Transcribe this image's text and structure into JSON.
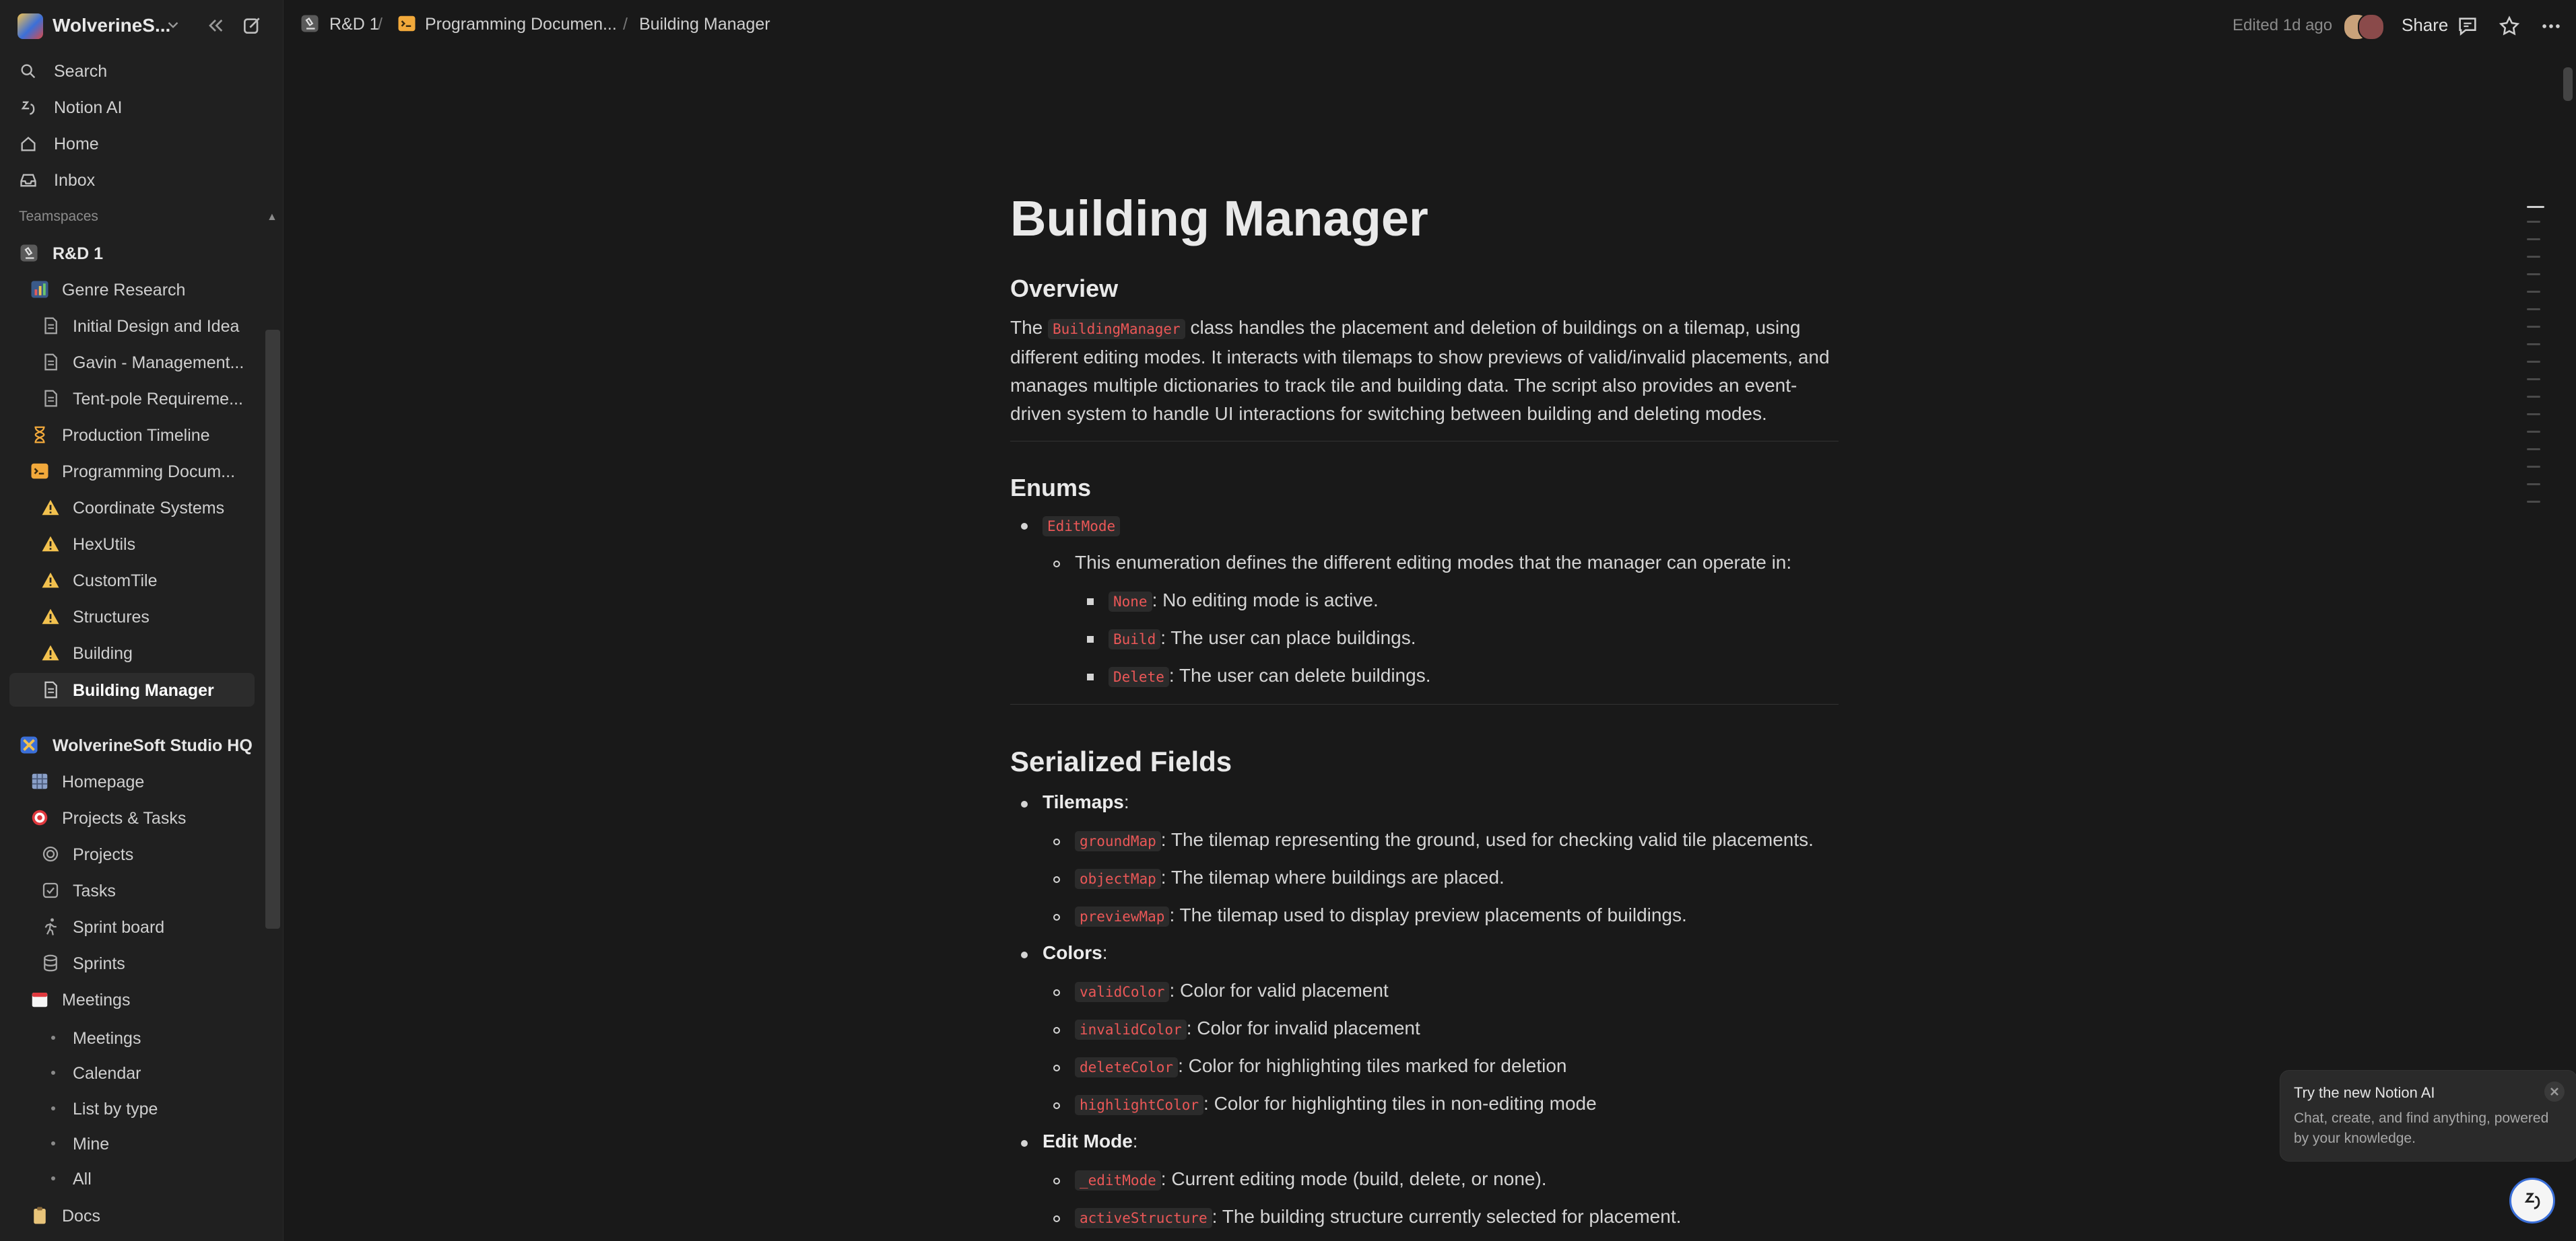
{
  "workspace": {
    "name": "WolverineS..."
  },
  "nav": [
    {
      "label": "Search",
      "icon": "search-icon"
    },
    {
      "label": "Notion AI",
      "icon": "notion-ai-icon"
    },
    {
      "label": "Home",
      "icon": "home-icon"
    },
    {
      "label": "Inbox",
      "icon": "inbox-icon"
    }
  ],
  "sidebar": {
    "section_label": "Teamspaces",
    "tree": [
      {
        "label": "R&D 1"
      },
      {
        "label": "Genre Research"
      },
      {
        "label": "Initial Design and Idea"
      },
      {
        "label": "Gavin - Management..."
      },
      {
        "label": "Tent-pole Requireme..."
      },
      {
        "label": "Production Timeline"
      },
      {
        "label": "Programming Docum..."
      },
      {
        "label": "Coordinate Systems"
      },
      {
        "label": "HexUtils"
      },
      {
        "label": "CustomTile"
      },
      {
        "label": "Structures"
      },
      {
        "label": "Building"
      },
      {
        "label": "Building Manager"
      },
      {
        "label": "WolverineSoft Studio HQ"
      },
      {
        "label": "Homepage"
      },
      {
        "label": "Projects & Tasks"
      },
      {
        "label": "Projects"
      },
      {
        "label": "Tasks"
      },
      {
        "label": "Sprint board"
      },
      {
        "label": "Sprints"
      },
      {
        "label": "Meetings"
      },
      {
        "label": "Meetings"
      },
      {
        "label": "Calendar"
      },
      {
        "label": "List by type"
      },
      {
        "label": "Mine"
      },
      {
        "label": "All"
      },
      {
        "label": "Docs"
      }
    ]
  },
  "topbar": {
    "breadcrumbs": [
      {
        "label": "R&D 1"
      },
      {
        "label": "Programming Documen..."
      },
      {
        "label": "Building Manager"
      }
    ],
    "separator": "/",
    "edited": "Edited 1d ago",
    "share": "Share"
  },
  "page": {
    "title": "Building Manager",
    "overview_heading": "Overview",
    "overview": {
      "pre": "The ",
      "code": "BuildingManager",
      "post": " class handles the placement and deletion of buildings on a tilemap, using different editing modes. It interacts with tilemaps to show previews of valid/invalid placements, and manages multiple dictionaries to track tile and building data. The script also provides an event-driven system to handle UI interactions for switching between building and deleting modes."
    },
    "enums_heading": "Enums",
    "enum_name": "EditMode",
    "enum_desc": "This enumeration defines the different editing modes that the manager can operate in:",
    "enum_values": [
      {
        "code": "None",
        "text": ": No editing mode is active."
      },
      {
        "code": "Build",
        "text": ": The user can place buildings."
      },
      {
        "code": "Delete",
        "text": ": The user can delete buildings."
      }
    ],
    "serialized_heading": "Serialized Fields",
    "groups": [
      {
        "label": "Tilemaps",
        "colon": ":",
        "items": [
          {
            "code": "groundMap",
            "text": ": The tilemap representing the ground, used for checking valid tile placements."
          },
          {
            "code": "objectMap",
            "text": ": The tilemap where buildings are placed."
          },
          {
            "code": "previewMap",
            "text": ": The tilemap used to display preview placements of buildings."
          }
        ]
      },
      {
        "label": "Colors",
        "colon": ":",
        "items": [
          {
            "code": "validColor",
            "text": ": Color for valid placement"
          },
          {
            "code": "invalidColor",
            "text": ": Color for invalid placement"
          },
          {
            "code": "deleteColor",
            "text": ": Color for highlighting tiles marked for deletion"
          },
          {
            "code": "highlightColor",
            "text": ": Color for highlighting tiles in non-editing mode"
          }
        ]
      },
      {
        "label": "Edit Mode",
        "colon": ":",
        "items": [
          {
            "code": "_editMode",
            "text": ": Current editing mode (build, delete, or none)."
          },
          {
            "code": "activeStructure",
            "text": ": The building structure currently selected for placement."
          }
        ]
      }
    ]
  },
  "ai_popup": {
    "title": "Try the new Notion AI",
    "body": "Chat, create, and find anything, powered by your knowledge."
  },
  "colors": {
    "code_text": "#eb5757",
    "background": "#191919",
    "sidebar": "#202020"
  }
}
